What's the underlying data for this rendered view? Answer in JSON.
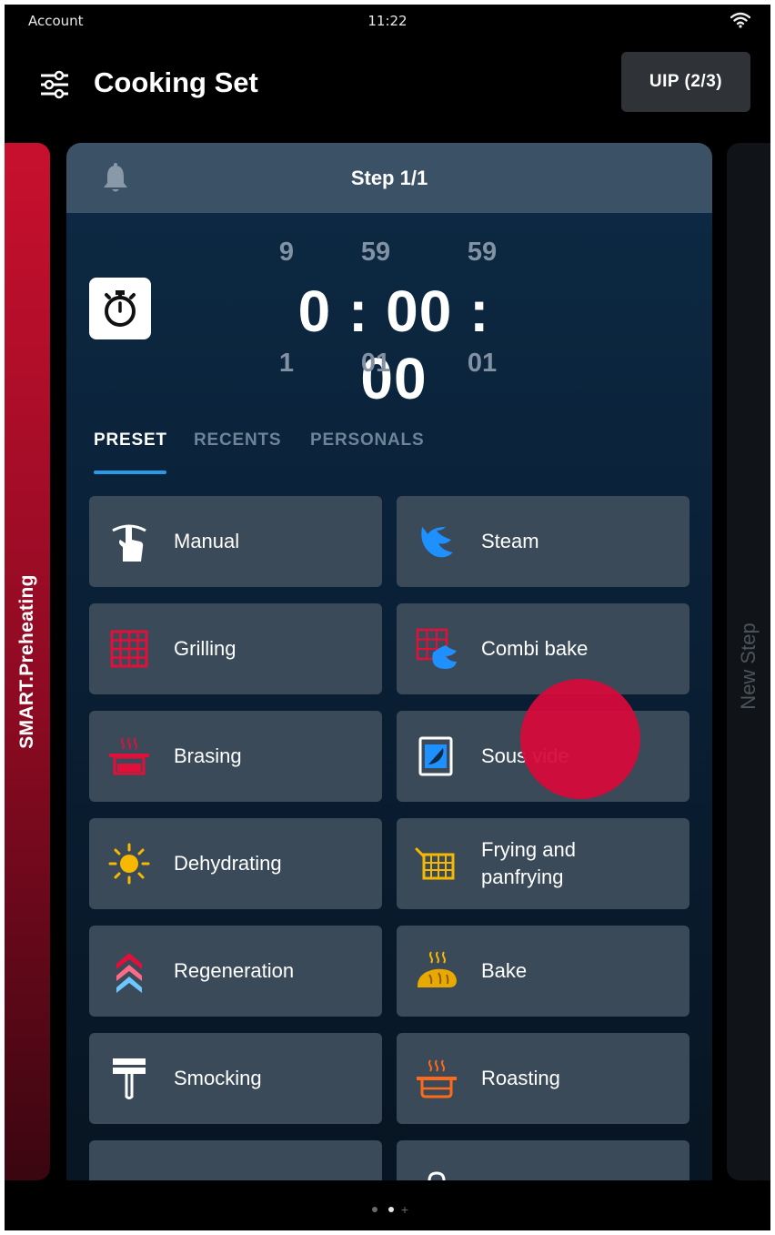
{
  "status_bar": {
    "account": "Account",
    "time": "11:22"
  },
  "header": {
    "title": "Cooking Set",
    "uip_button": "UIP (2/3)"
  },
  "side_panels": {
    "left_label": "SMART.Preheating",
    "right_label": "New Step"
  },
  "card": {
    "step_label": "Step 1/1",
    "timer": {
      "above": [
        "9",
        "59",
        "59"
      ],
      "main": "0 : 00 : 00",
      "below": [
        "1",
        "01",
        "01"
      ]
    },
    "tabs": [
      "PRESET",
      "RECENTS",
      "PERSONALS"
    ],
    "active_tab": "PRESET",
    "presets": [
      {
        "label": "Manual",
        "icon": "hand-pointer-icon"
      },
      {
        "label": "Steam",
        "icon": "steam-icon"
      },
      {
        "label": "Grilling",
        "icon": "grill-icon"
      },
      {
        "label": "Combi bake",
        "icon": "combi-bake-icon"
      },
      {
        "label": "Brasing",
        "icon": "braising-pot-icon"
      },
      {
        "label": "Sous vide",
        "icon": "sous-vide-icon"
      },
      {
        "label": "Dehydrating",
        "icon": "sun-icon"
      },
      {
        "label": "Frying and panfrying",
        "icon": "frying-basket-icon"
      },
      {
        "label": "Regeneration",
        "icon": "regeneration-chevrons-icon"
      },
      {
        "label": "Bake",
        "icon": "bread-icon"
      },
      {
        "label": "Smocking",
        "icon": "smoking-icon"
      },
      {
        "label": "Roasting",
        "icon": "roasting-pan-icon"
      },
      {
        "label": "",
        "icon": "wave-icon"
      },
      {
        "label": "",
        "icon": "lock-icon"
      }
    ]
  },
  "colors": {
    "accent_blue": "#2a9ae8",
    "smart_red": "#c8102e",
    "tap_indicator": "#d70a3a",
    "tile_bg": "#3a4a58"
  }
}
